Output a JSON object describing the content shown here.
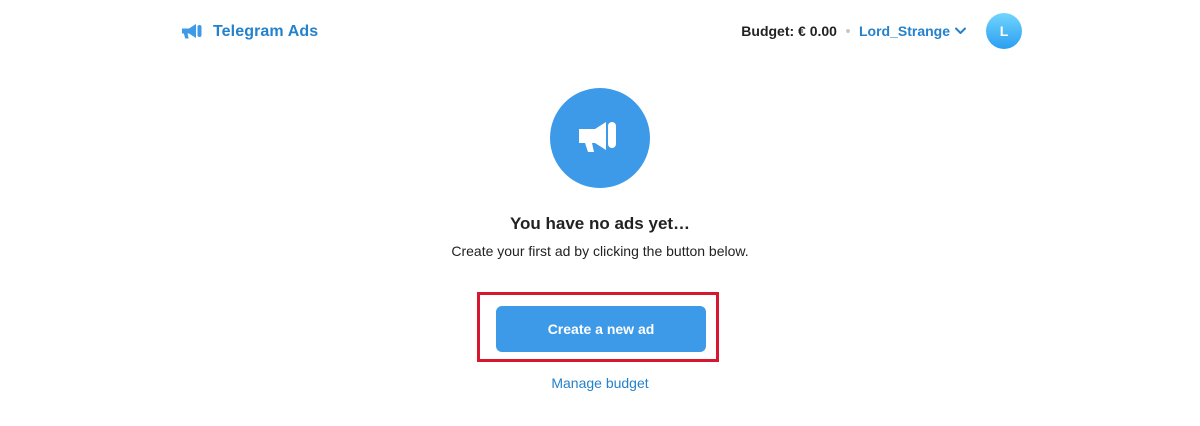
{
  "header": {
    "brand": {
      "icon": "megaphone-icon",
      "label": "Telegram Ads"
    },
    "budget_label": "Budget: € 0.00",
    "username": "Lord_Strange",
    "username_icon": "chevron-down-icon",
    "avatar_initial": "L"
  },
  "empty_state": {
    "icon": "megaphone-icon",
    "title": "You have no ads yet…",
    "subtitle": "Create your first ad by clicking the button below."
  },
  "actions": {
    "create_label": "Create a new ad",
    "manage_label": "Manage budget"
  },
  "colors": {
    "accent": "#2481cc",
    "button": "#3d9ae8",
    "highlight_border": "#d7172f",
    "avatar_top": "#72d5fd",
    "avatar_bottom": "#2a9ef1"
  }
}
